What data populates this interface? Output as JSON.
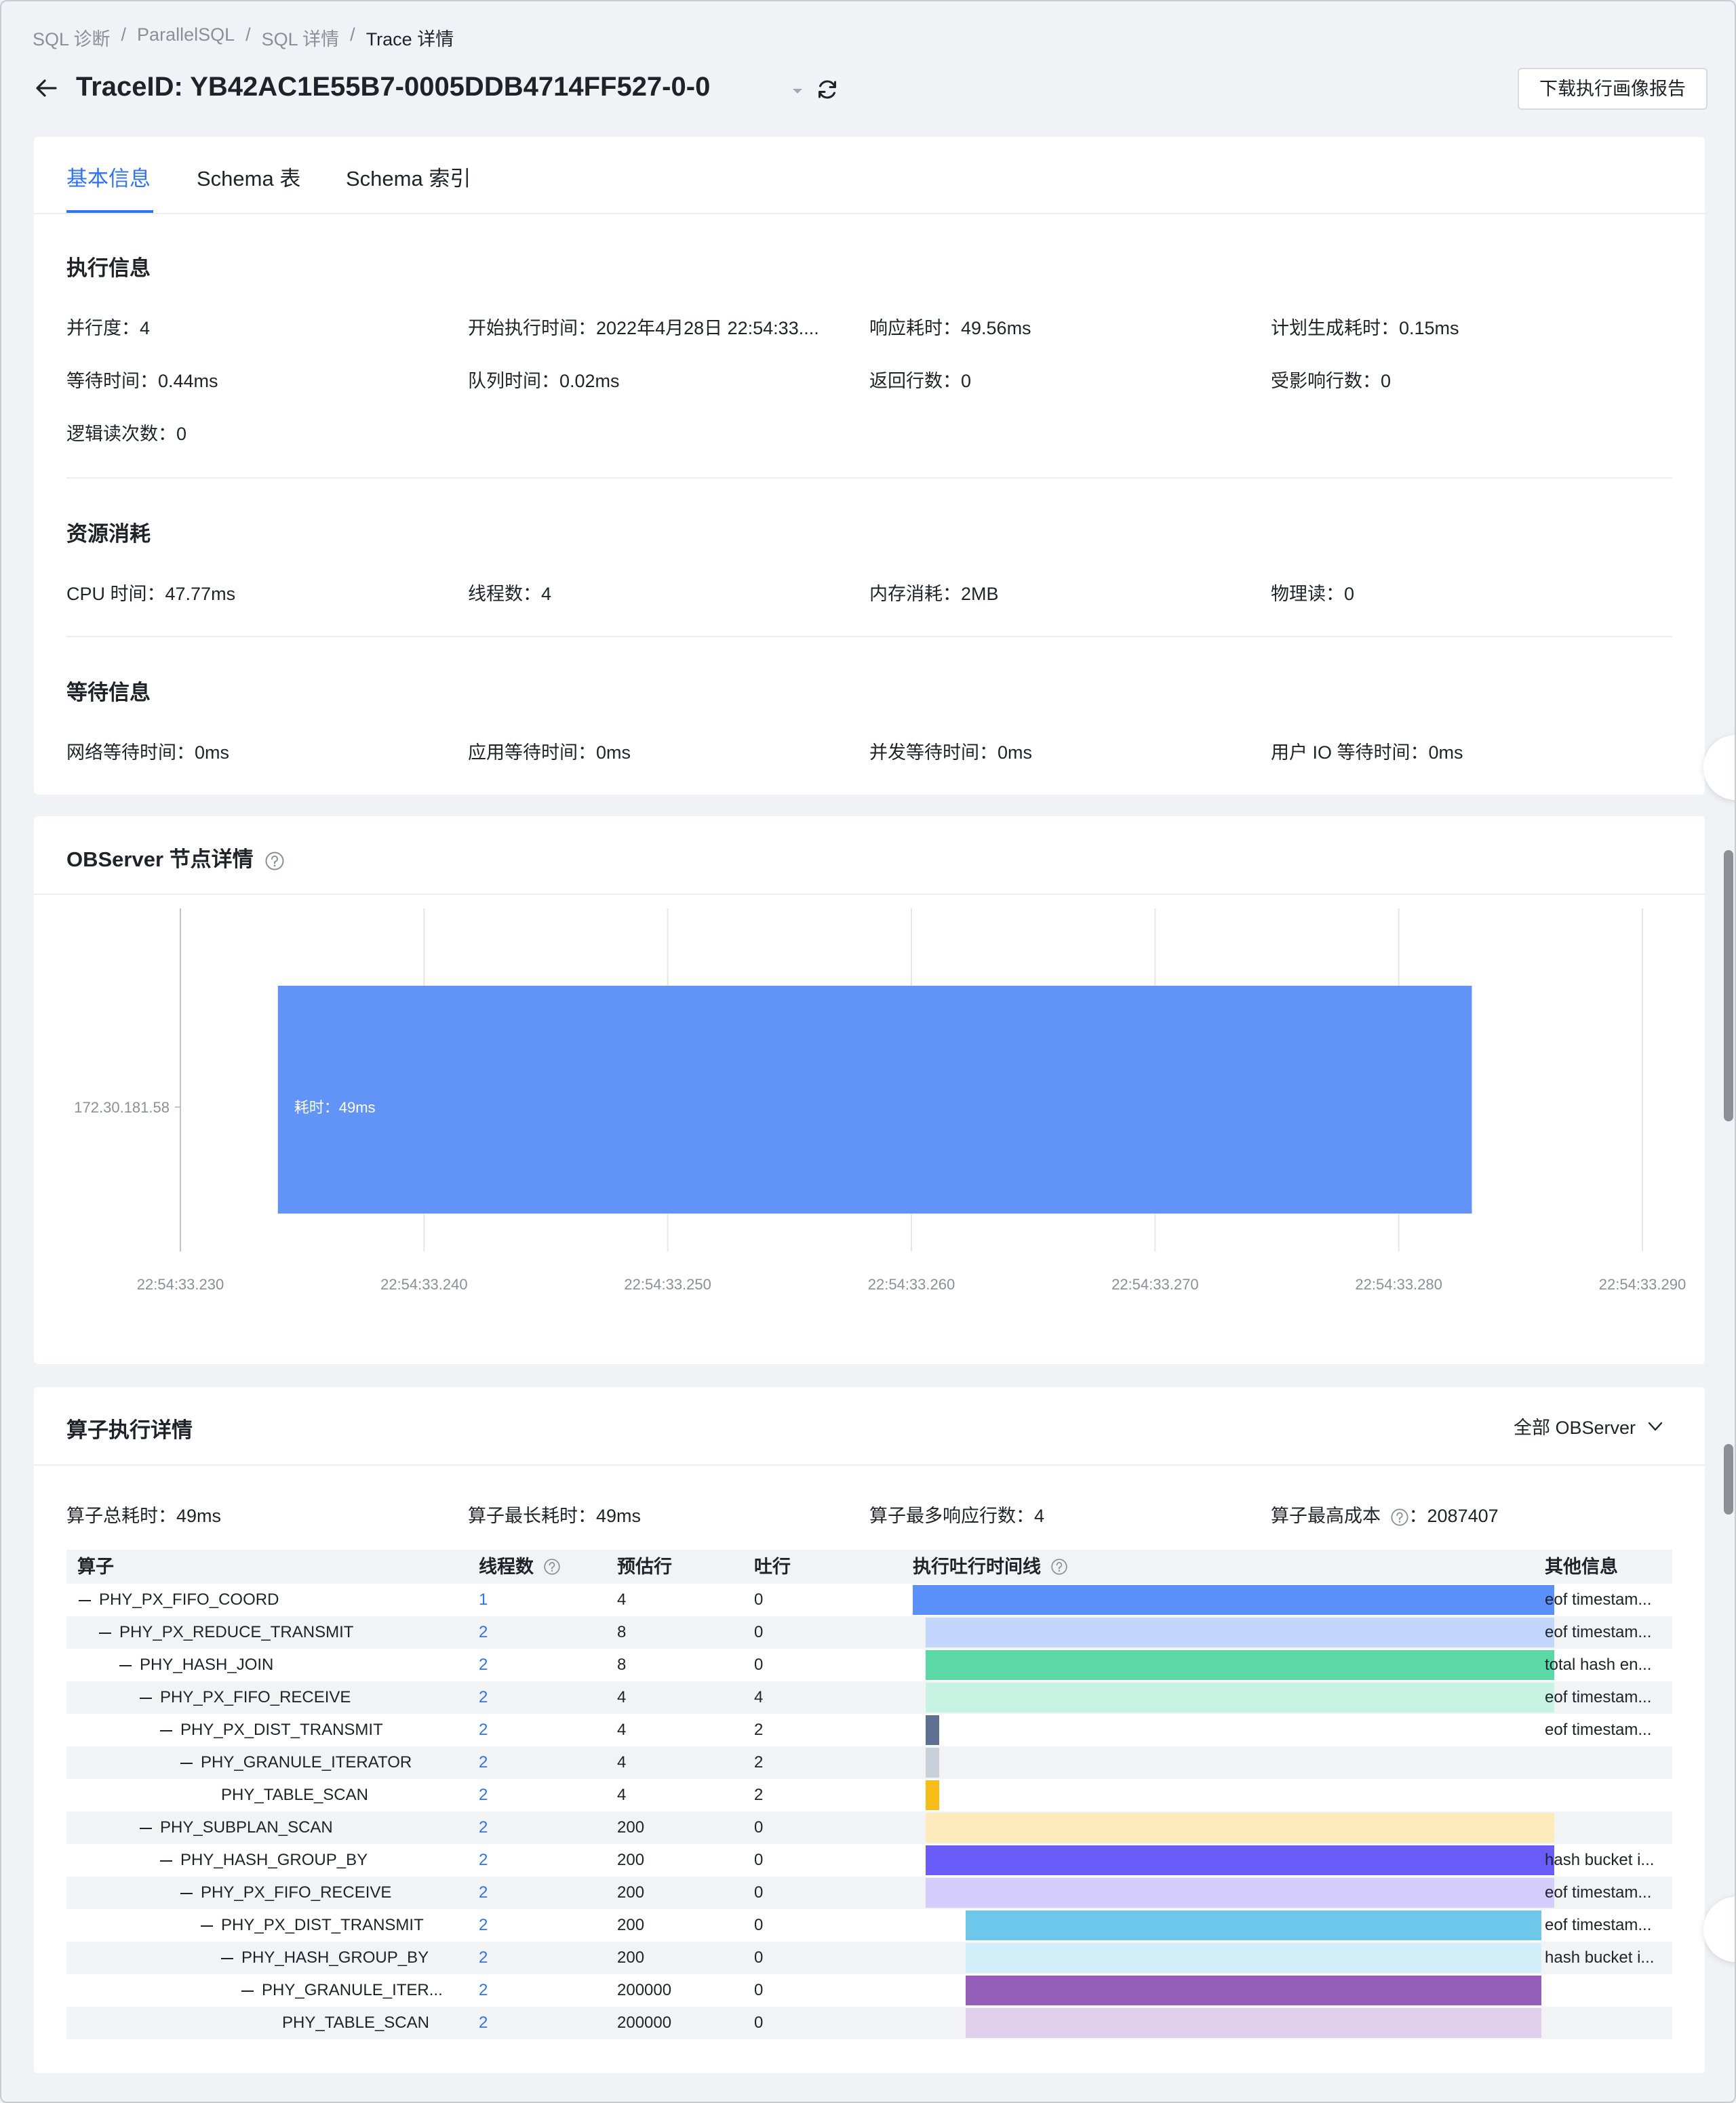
{
  "breadcrumb": [
    "SQL 诊断",
    "ParallelSQL",
    "SQL 详情",
    "Trace 详情"
  ],
  "header": {
    "title": "TraceID:  YB42AC1E55B7-0005DDB4714FF527-0-0",
    "download_label": "下载执行画像报告"
  },
  "tabs": [
    "基本信息",
    "Schema 表",
    "Schema 索引"
  ],
  "exec_info": {
    "title": "执行信息",
    "items": [
      "并行度：4",
      "开始执行时间：2022年4月28日 22:54:33....",
      "响应耗时：49.56ms",
      "计划生成耗时：0.15ms",
      "等待时间：0.44ms",
      "队列时间：0.02ms",
      "返回行数：0",
      "受影响行数：0",
      "逻辑读次数：0"
    ]
  },
  "resource": {
    "title": "资源消耗",
    "items": [
      "CPU 时间：47.77ms",
      "线程数：4",
      "内存消耗：2MB",
      "物理读：0"
    ]
  },
  "wait_info": {
    "title": "等待信息",
    "items": [
      "网络等待时间：0ms",
      "应用等待时间：0ms",
      "并发等待时间：0ms",
      "用户 IO 等待时间：0ms"
    ]
  },
  "observer": {
    "title": "OBServer 节点详情",
    "help_icon": "question-circle-icon"
  },
  "chart_data": {
    "type": "bar",
    "orientation": "horizontal",
    "categories": [
      "172.30.181.58"
    ],
    "series": [
      {
        "values": [
          {
            "start": "22:54:33.234",
            "end": "22:54:33.283"
          }
        ],
        "label": "耗时：49ms",
        "color": "#6294f7"
      }
    ],
    "x_ticks": [
      "22:54:33.230",
      "22:54:33.240",
      "22:54:33.250",
      "22:54:33.260",
      "22:54:33.270",
      "22:54:33.280",
      "22:54:33.290"
    ],
    "xlim": [
      "22:54:33.230",
      "22:54:33.290"
    ],
    "grid": true
  },
  "operators": {
    "title": "算子执行详情",
    "select_label": "全部 OBServer",
    "summary": [
      "算子总耗时：49ms",
      "算子最长耗时：49ms",
      "算子最多响应行数：4",
      "算子最高成本",
      "：2087407"
    ],
    "columns": [
      "算子",
      "线程数",
      "预估行",
      "吐行",
      "执行吐行时间线",
      "其他信息"
    ],
    "rows": [
      {
        "name": "PHY_PX_FIFO_COORD",
        "depth": 0,
        "toggle": true,
        "threads": "1",
        "est": "4",
        "out": "0",
        "tl": [
          0.0,
          1.0
        ],
        "color": "#5b8ff9",
        "info": "eof timestam..."
      },
      {
        "name": "PHY_PX_REDUCE_TRANSMIT",
        "depth": 1,
        "toggle": true,
        "threads": "2",
        "est": "8",
        "out": "0",
        "tl": [
          0.02,
          1.0
        ],
        "color": "#c2d6fb",
        "info": "eof timestam..."
      },
      {
        "name": "PHY_HASH_JOIN",
        "depth": 2,
        "toggle": true,
        "threads": "2",
        "est": "8",
        "out": "0",
        "tl": [
          0.02,
          1.0
        ],
        "color": "#5ad8a6",
        "info": "total hash en..."
      },
      {
        "name": "PHY_PX_FIFO_RECEIVE",
        "depth": 3,
        "toggle": true,
        "threads": "2",
        "est": "4",
        "out": "4",
        "tl": [
          0.02,
          1.0
        ],
        "color": "#c8f2e1",
        "info": "eof timestam..."
      },
      {
        "name": "PHY_PX_DIST_TRANSMIT",
        "depth": 4,
        "toggle": true,
        "threads": "2",
        "est": "4",
        "out": "2",
        "tl": [
          0.02,
          0.041
        ],
        "color": "#5d7092",
        "info": "eof timestam..."
      },
      {
        "name": "PHY_GRANULE_ITERATOR",
        "depth": 5,
        "toggle": true,
        "threads": "2",
        "est": "4",
        "out": "2",
        "tl": [
          0.02,
          0.041
        ],
        "color": "#c9d0dc",
        "info": ""
      },
      {
        "name": "PHY_TABLE_SCAN",
        "depth": 6,
        "toggle": false,
        "threads": "2",
        "est": "4",
        "out": "2",
        "tl": [
          0.02,
          0.041
        ],
        "color": "#f6bd16",
        "info": ""
      },
      {
        "name": "PHY_SUBPLAN_SCAN",
        "depth": 3,
        "toggle": true,
        "threads": "2",
        "est": "200",
        "out": "0",
        "tl": [
          0.02,
          1.0
        ],
        "color": "#fdebbc",
        "info": ""
      },
      {
        "name": "PHY_HASH_GROUP_BY",
        "depth": 4,
        "toggle": true,
        "threads": "2",
        "est": "200",
        "out": "0",
        "tl": [
          0.02,
          1.0
        ],
        "color": "#6a5cf8",
        "info": "hash bucket i..."
      },
      {
        "name": "PHY_PX_FIFO_RECEIVE",
        "depth": 5,
        "toggle": true,
        "threads": "2",
        "est": "200",
        "out": "0",
        "tl": [
          0.02,
          1.0
        ],
        "color": "#d3ccfd",
        "info": "eof timestam..."
      },
      {
        "name": "PHY_PX_DIST_TRANSMIT",
        "depth": 6,
        "toggle": true,
        "threads": "2",
        "est": "200",
        "out": "0",
        "tl": [
          0.082,
          0.98
        ],
        "color": "#6dc8ec",
        "info": "eof timestam..."
      },
      {
        "name": "PHY_HASH_GROUP_BY",
        "depth": 7,
        "toggle": true,
        "threads": "2",
        "est": "200",
        "out": "0",
        "tl": [
          0.082,
          0.98
        ],
        "color": "#d2eef9",
        "info": "hash bucket i..."
      },
      {
        "name": "PHY_GRANULE_ITER...",
        "depth": 8,
        "toggle": true,
        "threads": "2",
        "est": "200000",
        "out": "0",
        "tl": [
          0.082,
          0.98
        ],
        "color": "#945fb9",
        "info": ""
      },
      {
        "name": "PHY_TABLE_SCAN",
        "depth": 9,
        "toggle": false,
        "threads": "2",
        "est": "200000",
        "out": "0",
        "tl": [
          0.082,
          0.98
        ],
        "color": "#dfcfea",
        "info": ""
      }
    ]
  }
}
